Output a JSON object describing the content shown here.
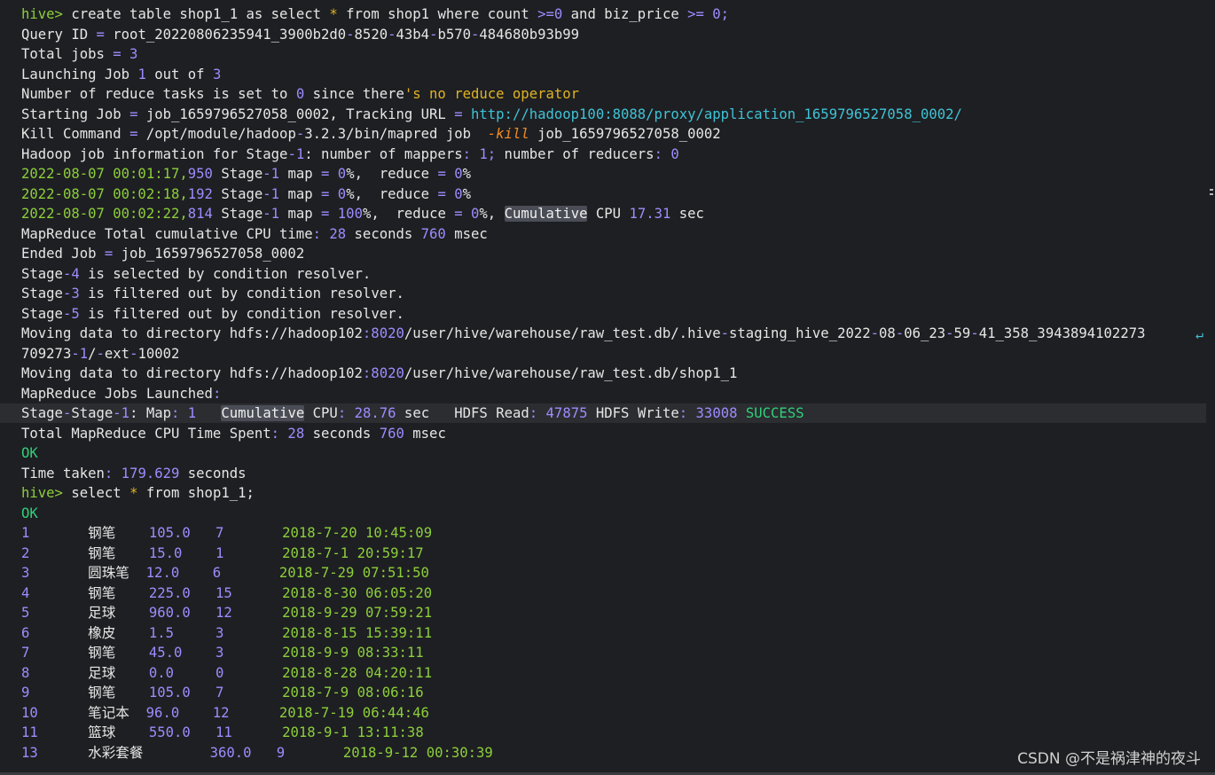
{
  "terminal": {
    "lines": [
      [
        [
          "hive> ",
          "t-green"
        ],
        [
          "create table shop1_1 as select ",
          ""
        ],
        [
          "*",
          "t-gold"
        ],
        [
          " from shop1 where count ",
          ""
        ],
        [
          ">=0",
          "t-purple"
        ],
        [
          " and biz_price ",
          ""
        ],
        [
          ">= 0;",
          "t-purple"
        ]
      ],
      [
        [
          "Query ID ",
          ""
        ],
        [
          "=",
          "t-purple"
        ],
        [
          " root_20220806235941_3900b2d0",
          ""
        ],
        [
          "-",
          "t-purple"
        ],
        [
          "8520",
          ""
        ],
        [
          "-",
          "t-purple"
        ],
        [
          "43b4",
          ""
        ],
        [
          "-",
          "t-purple"
        ],
        [
          "b570",
          ""
        ],
        [
          "-",
          "t-purple"
        ],
        [
          "484680b93b99",
          ""
        ]
      ],
      [
        [
          "Total jobs ",
          ""
        ],
        [
          "= 3",
          "t-purple"
        ]
      ],
      [
        [
          "Launching Job ",
          ""
        ],
        [
          "1",
          "t-purple"
        ],
        [
          " out of ",
          ""
        ],
        [
          "3",
          "t-purple"
        ]
      ],
      [
        [
          "Number of reduce tasks is set to ",
          ""
        ],
        [
          "0",
          "t-purple"
        ],
        [
          " since there",
          ""
        ],
        [
          "'s no reduce operator",
          "t-gold"
        ]
      ],
      [
        [
          "Starting Job ",
          ""
        ],
        [
          "=",
          "t-purple"
        ],
        [
          " job_1659796527058_0002, Tracking URL ",
          ""
        ],
        [
          "=",
          "t-purple"
        ],
        [
          " ",
          ""
        ],
        [
          "http://hadoop100:8088/proxy/application_1659796527058_0002/",
          "t-cyan"
        ]
      ],
      [
        [
          "Kill Command ",
          ""
        ],
        [
          "=",
          "t-purple"
        ],
        [
          " /opt/module/hadoop",
          ""
        ],
        [
          "-",
          "t-purple"
        ],
        [
          "3.2.3/bin/mapred job  ",
          ""
        ],
        [
          "-kill",
          "t-orange"
        ],
        [
          " job_1659796527058_0002",
          ""
        ]
      ],
      [
        [
          "Hadoop job information for Stage",
          ""
        ],
        [
          "-1",
          "t-purple"
        ],
        [
          ": number of mappers",
          ""
        ],
        [
          ": 1;",
          "t-purple"
        ],
        [
          " number of reducers",
          ""
        ],
        [
          ": 0",
          "t-purple"
        ]
      ],
      [
        [
          "2022-08-07 00:01:17,",
          "t-green"
        ],
        [
          "950",
          "t-purple"
        ],
        [
          " Stage",
          ""
        ],
        [
          "-1",
          "t-purple"
        ],
        [
          " map ",
          ""
        ],
        [
          "= 0",
          "t-purple"
        ],
        [
          "%,  reduce ",
          ""
        ],
        [
          "= 0",
          "t-purple"
        ],
        [
          "%",
          ""
        ]
      ],
      [
        [
          "2022-08-07 00:02:18,",
          "t-green"
        ],
        [
          "192",
          "t-purple"
        ],
        [
          " Stage",
          ""
        ],
        [
          "-1",
          "t-purple"
        ],
        [
          " map ",
          ""
        ],
        [
          "= 0",
          "t-purple"
        ],
        [
          "%,  reduce ",
          ""
        ],
        [
          "= 0",
          "t-purple"
        ],
        [
          "%",
          ""
        ]
      ],
      [
        [
          "2022-08-07 00:02:22,",
          "t-green"
        ],
        [
          "814",
          "t-purple"
        ],
        [
          " Stage",
          ""
        ],
        [
          "-1",
          "t-purple"
        ],
        [
          " map ",
          ""
        ],
        [
          "= 100",
          "t-purple"
        ],
        [
          "%,  reduce ",
          ""
        ],
        [
          "= 0",
          "t-purple"
        ],
        [
          "%, ",
          ""
        ],
        [
          "Cumulative",
          "t-box"
        ],
        [
          " CPU ",
          ""
        ],
        [
          "17.31",
          "t-purple"
        ],
        [
          " sec",
          ""
        ]
      ],
      [
        [
          "MapReduce Total cumulative CPU time",
          ""
        ],
        [
          ": 28",
          "t-purple"
        ],
        [
          " seconds ",
          ""
        ],
        [
          "760",
          "t-purple"
        ],
        [
          " msec",
          ""
        ]
      ],
      [
        [
          "Ended Job ",
          ""
        ],
        [
          "=",
          "t-purple"
        ],
        [
          " job_1659796527058_0002",
          ""
        ]
      ],
      [
        [
          "Stage",
          ""
        ],
        [
          "-4",
          "t-purple"
        ],
        [
          " is selected by condition resolver.",
          ""
        ]
      ],
      [
        [
          "Stage",
          ""
        ],
        [
          "-3",
          "t-purple"
        ],
        [
          " is filtered out by condition resolver.",
          ""
        ]
      ],
      [
        [
          "Stage",
          ""
        ],
        [
          "-5",
          "t-purple"
        ],
        [
          " is filtered out by condition resolver.",
          ""
        ]
      ],
      [
        [
          "Moving data to directory hdfs://hadoop102",
          ""
        ],
        [
          ":8020",
          "t-purple"
        ],
        [
          "/user/hive/warehouse/raw_test.db/.hive",
          ""
        ],
        [
          "-",
          "t-purple"
        ],
        [
          "staging_hive_2022",
          ""
        ],
        [
          "-",
          "t-purple"
        ],
        [
          "08",
          ""
        ],
        [
          "-",
          "t-purple"
        ],
        [
          "06_23",
          ""
        ],
        [
          "-",
          "t-purple"
        ],
        [
          "59",
          ""
        ],
        [
          "-",
          "t-purple"
        ],
        [
          "41_358_3943894102273",
          ""
        ]
      ],
      [
        [
          "709273",
          ""
        ],
        [
          "-1",
          "t-purple"
        ],
        [
          "/",
          ""
        ],
        [
          "-",
          "t-purple"
        ],
        [
          "ext",
          ""
        ],
        [
          "-",
          "t-purple"
        ],
        [
          "10002",
          ""
        ]
      ],
      [
        [
          "Moving data to directory hdfs://hadoop102",
          ""
        ],
        [
          ":8020",
          "t-purple"
        ],
        [
          "/user/hive/warehouse/raw_test.db/shop1_1",
          ""
        ]
      ],
      [
        [
          "MapReduce Jobs Launched",
          ""
        ],
        [
          ":",
          "t-purple"
        ]
      ],
      [
        [
          "Stage",
          ""
        ],
        [
          "-",
          "t-purple"
        ],
        [
          "Stage",
          ""
        ],
        [
          "-1",
          "t-purple"
        ],
        [
          ": Map",
          ""
        ],
        [
          ": 1",
          "t-purple"
        ],
        [
          "   ",
          ""
        ],
        [
          "Cumulative",
          "t-box"
        ],
        [
          " CPU",
          ""
        ],
        [
          ": 28.76",
          "t-purple"
        ],
        [
          " sec   HDFS Read",
          ""
        ],
        [
          ": 47875",
          "t-purple"
        ],
        [
          " HDFS Write",
          ""
        ],
        [
          ": 33008",
          "t-purple"
        ],
        [
          " ",
          ""
        ],
        [
          "SUCCESS",
          "t-ok"
        ]
      ],
      [
        [
          "Total MapReduce CPU Time Spent",
          ""
        ],
        [
          ": 28",
          "t-purple"
        ],
        [
          " seconds ",
          ""
        ],
        [
          "760",
          "t-purple"
        ],
        [
          " msec",
          ""
        ]
      ],
      [
        [
          "OK",
          "t-ok"
        ]
      ],
      [
        [
          "Time taken",
          ""
        ],
        [
          ": 179.629",
          "t-purple"
        ],
        [
          " seconds",
          ""
        ]
      ],
      [
        [
          "hive> ",
          "t-green"
        ],
        [
          "select ",
          ""
        ],
        [
          "*",
          "t-gold"
        ],
        [
          " from shop1_1;",
          ""
        ]
      ],
      [
        [
          "OK",
          "t-ok"
        ]
      ],
      [
        [
          "1",
          "t-purple"
        ],
        [
          "       钢笔    ",
          ""
        ],
        [
          "105.0",
          "t-purple"
        ],
        [
          "   ",
          ""
        ],
        [
          "7",
          "t-purple"
        ],
        [
          "       ",
          ""
        ],
        [
          "2018-7-20 10:45:09",
          "t-green"
        ]
      ],
      [
        [
          "2",
          "t-purple"
        ],
        [
          "       钢笔    ",
          ""
        ],
        [
          "15.0",
          "t-purple"
        ],
        [
          "    ",
          ""
        ],
        [
          "1",
          "t-purple"
        ],
        [
          "       ",
          ""
        ],
        [
          "2018-7-1 20:59:17",
          "t-green"
        ]
      ],
      [
        [
          "3",
          "t-purple"
        ],
        [
          "       圆珠笔  ",
          ""
        ],
        [
          "12.0",
          "t-purple"
        ],
        [
          "    ",
          ""
        ],
        [
          "6",
          "t-purple"
        ],
        [
          "       ",
          ""
        ],
        [
          "2018-7-29 07:51:50",
          "t-green"
        ]
      ],
      [
        [
          "4",
          "t-purple"
        ],
        [
          "       钢笔    ",
          ""
        ],
        [
          "225.0",
          "t-purple"
        ],
        [
          "   ",
          ""
        ],
        [
          "15",
          "t-purple"
        ],
        [
          "      ",
          ""
        ],
        [
          "2018-8-30 06:05:20",
          "t-green"
        ]
      ],
      [
        [
          "5",
          "t-purple"
        ],
        [
          "       足球    ",
          ""
        ],
        [
          "960.0",
          "t-purple"
        ],
        [
          "   ",
          ""
        ],
        [
          "12",
          "t-purple"
        ],
        [
          "      ",
          ""
        ],
        [
          "2018-9-29 07:59:21",
          "t-green"
        ]
      ],
      [
        [
          "6",
          "t-purple"
        ],
        [
          "       橡皮    ",
          ""
        ],
        [
          "1.5",
          "t-purple"
        ],
        [
          "     ",
          ""
        ],
        [
          "3",
          "t-purple"
        ],
        [
          "       ",
          ""
        ],
        [
          "2018-8-15 15:39:11",
          "t-green"
        ]
      ],
      [
        [
          "7",
          "t-purple"
        ],
        [
          "       钢笔    ",
          ""
        ],
        [
          "45.0",
          "t-purple"
        ],
        [
          "    ",
          ""
        ],
        [
          "3",
          "t-purple"
        ],
        [
          "       ",
          ""
        ],
        [
          "2018-9-9 08:33:11",
          "t-green"
        ]
      ],
      [
        [
          "8",
          "t-purple"
        ],
        [
          "       足球    ",
          ""
        ],
        [
          "0.0",
          "t-purple"
        ],
        [
          "     ",
          ""
        ],
        [
          "0",
          "t-purple"
        ],
        [
          "       ",
          ""
        ],
        [
          "2018-8-28 04:20:11",
          "t-green"
        ]
      ],
      [
        [
          "9",
          "t-purple"
        ],
        [
          "       钢笔    ",
          ""
        ],
        [
          "105.0",
          "t-purple"
        ],
        [
          "   ",
          ""
        ],
        [
          "7",
          "t-purple"
        ],
        [
          "       ",
          ""
        ],
        [
          "2018-7-9 08:06:16",
          "t-green"
        ]
      ],
      [
        [
          "10",
          "t-purple"
        ],
        [
          "      笔记本  ",
          ""
        ],
        [
          "96.0",
          "t-purple"
        ],
        [
          "    ",
          ""
        ],
        [
          "12",
          "t-purple"
        ],
        [
          "      ",
          ""
        ],
        [
          "2018-7-19 06:44:46",
          "t-green"
        ]
      ],
      [
        [
          "11",
          "t-purple"
        ],
        [
          "      篮球    ",
          ""
        ],
        [
          "550.0",
          "t-purple"
        ],
        [
          "   ",
          ""
        ],
        [
          "11",
          "t-purple"
        ],
        [
          "      ",
          ""
        ],
        [
          "2018-9-1 13:11:38",
          "t-green"
        ]
      ],
      [
        [
          "13",
          "t-purple"
        ],
        [
          "      水彩套餐        ",
          ""
        ],
        [
          "360.0",
          "t-purple"
        ],
        [
          "   ",
          ""
        ],
        [
          "9",
          "t-purple"
        ],
        [
          "       ",
          ""
        ],
        [
          "2018-9-12 00:30:39",
          "t-green"
        ]
      ]
    ],
    "highlight_line": 20,
    "wrap_marker": "↵"
  },
  "watermark": "CSDN @不是祸津神的夜斗"
}
